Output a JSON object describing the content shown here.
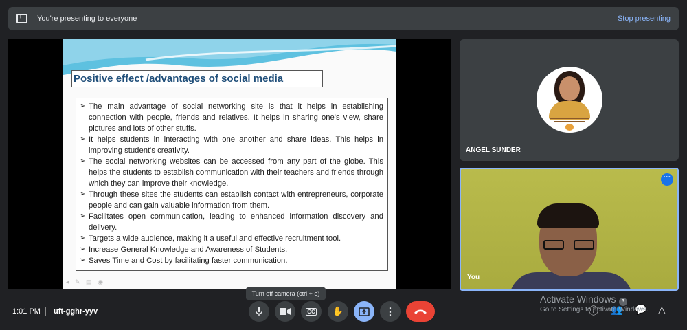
{
  "banner": {
    "message": "You're presenting to everyone",
    "stop_label": "Stop presenting",
    "icon": "present-to-all-icon"
  },
  "slide": {
    "title": "Positive effect /advantages of social media",
    "bullets": [
      "The main advantage of social networking site is that it helps in establishing connection with people, friends and relatives. It helps in sharing one's view, share pictures and lots of other stuffs.",
      "It helps students in interacting with one another and share ideas.  This helps in improving student's creativity.",
      "The social networking websites can be accessed from any part of the globe. This helps the students to establish communication with their teachers and friends through which they can improve their knowledge.",
      "Through these sites the students can establish contact with entrepreneurs, corporate people and can gain valuable information from them.",
      "Facilitates open communication, leading to enhanced information discovery and delivery.",
      "Targets a wide audience, making it a useful and effective recruitment tool.",
      "Increase General Knowledge and Awareness of Students.",
      "Saves Time and Cost by facilitating faster communication."
    ]
  },
  "participants": [
    {
      "name": "ANGEL SUNDER"
    },
    {
      "name": "You"
    }
  ],
  "meeting": {
    "time": "1:01 PM",
    "code": "uft-gghr-yyv"
  },
  "controls": {
    "tooltip": "Turn off camera (ctrl + e)",
    "mic_icon": "mic-icon",
    "camera_icon": "camera-icon",
    "captions_label": "CC",
    "hand_icon": "raise-hand-icon",
    "present_icon": "present-icon",
    "more_icon": "more-vert-icon",
    "hangup_icon": "hang-up-icon"
  },
  "right_controls": {
    "people_count": "3"
  },
  "watermark": {
    "line1": "Activate Windows",
    "line2": "Go to Settings to activate Windows."
  },
  "colors": {
    "background": "#202124",
    "accent": "#8ab4f8",
    "hangup": "#ea4335"
  }
}
